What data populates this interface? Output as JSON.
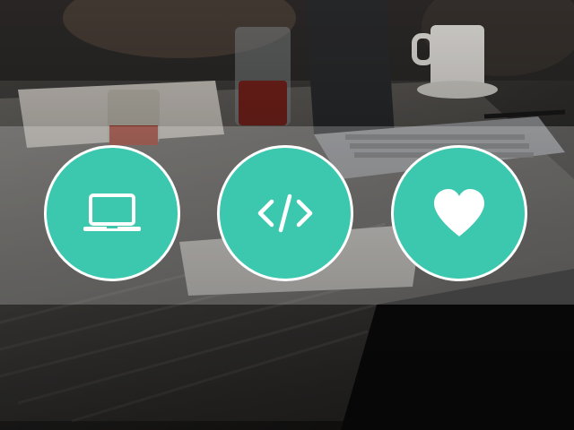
{
  "theme": {
    "accent": "#3cc7af",
    "ring": "#ffffff",
    "overlay": "rgba(255,255,255,0.22)"
  },
  "features": [
    {
      "icon": "laptop-icon"
    },
    {
      "icon": "code-icon"
    },
    {
      "icon": "heart-icon"
    }
  ]
}
